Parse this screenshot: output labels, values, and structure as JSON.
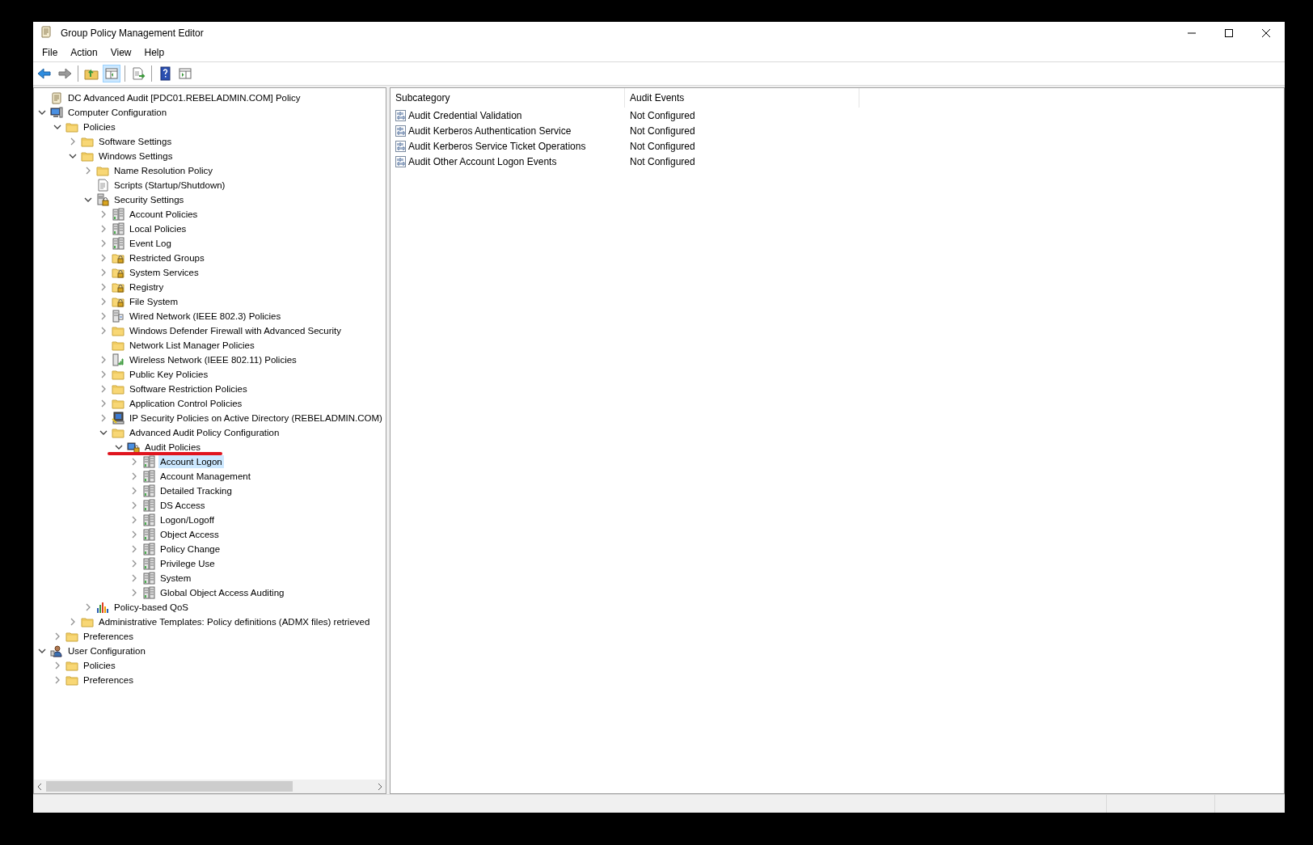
{
  "window": {
    "title": "Group Policy Management Editor"
  },
  "menu": [
    "File",
    "Action",
    "View",
    "Help"
  ],
  "toolbar": [
    {
      "kind": "back"
    },
    {
      "kind": "forward"
    },
    {
      "kind": "sep"
    },
    {
      "kind": "up",
      "pressed": false
    },
    {
      "kind": "tree",
      "pressed": true
    },
    {
      "kind": "sep"
    },
    {
      "kind": "export",
      "pressed": false
    },
    {
      "kind": "sep"
    },
    {
      "kind": "help",
      "pressed": false
    },
    {
      "kind": "view",
      "pressed": false
    }
  ],
  "tree": [
    {
      "label": "DC Advanced Audit [PDC01.REBELADMIN.COM] Policy",
      "kind": "scroll",
      "selected": false
    },
    {
      "label": "Computer Configuration",
      "kind": "computer",
      "expanded": true,
      "selected": false,
      "children": [
        {
          "label": "Policies",
          "kind": "folder",
          "expanded": true,
          "selected": false,
          "children": [
            {
              "label": "Software Settings",
              "kind": "folder",
              "expanded": false,
              "selected": false
            },
            {
              "label": "Windows Settings",
              "kind": "folder",
              "expanded": true,
              "selected": false,
              "children": [
                {
                  "label": "Name Resolution Policy",
                  "kind": "folder",
                  "expanded": false,
                  "selected": false
                },
                {
                  "label": "Scripts (Startup/Shutdown)",
                  "kind": "script",
                  "selected": false
                },
                {
                  "label": "Security Settings",
                  "kind": "security",
                  "expanded": true,
                  "selected": false,
                  "children": [
                    {
                      "label": "Account Policies",
                      "kind": "policy",
                      "expanded": false,
                      "selected": false
                    },
                    {
                      "label": "Local Policies",
                      "kind": "policy",
                      "expanded": false,
                      "selected": false
                    },
                    {
                      "label": "Event Log",
                      "kind": "policy",
                      "expanded": false,
                      "selected": false
                    },
                    {
                      "label": "Restricted Groups",
                      "kind": "lockfolder",
                      "expanded": false,
                      "selected": false
                    },
                    {
                      "label": "System Services",
                      "kind": "lockfolder",
                      "expanded": false,
                      "selected": false
                    },
                    {
                      "label": "Registry",
                      "kind": "lockfolder",
                      "expanded": false,
                      "selected": false
                    },
                    {
                      "label": "File System",
                      "kind": "lockfolder",
                      "expanded": false,
                      "selected": false
                    },
                    {
                      "label": "Wired Network (IEEE 802.3) Policies",
                      "kind": "wired",
                      "expanded": false,
                      "selected": false
                    },
                    {
                      "label": "Windows Defender Firewall with Advanced Security",
                      "kind": "folder",
                      "expanded": false,
                      "selected": false
                    },
                    {
                      "label": "Network List Manager Policies",
                      "kind": "folder",
                      "selected": false
                    },
                    {
                      "label": "Wireless Network (IEEE 802.11) Policies",
                      "kind": "wireless",
                      "expanded": false,
                      "selected": false
                    },
                    {
                      "label": "Public Key Policies",
                      "kind": "folder",
                      "expanded": false,
                      "selected": false
                    },
                    {
                      "label": "Software Restriction Policies",
                      "kind": "folder",
                      "expanded": false,
                      "selected": false
                    },
                    {
                      "label": "Application Control Policies",
                      "kind": "folder",
                      "expanded": false,
                      "selected": false
                    },
                    {
                      "label": "IP Security Policies on Active Directory (REBELADMIN.COM)",
                      "kind": "ipsec",
                      "expanded": false,
                      "selected": false
                    },
                    {
                      "label": "Advanced Audit Policy Configuration",
                      "kind": "folder",
                      "expanded": true,
                      "selected": false,
                      "children": [
                        {
                          "label": "Audit Policies",
                          "kind": "audit",
                          "expanded": true,
                          "selected": false,
                          "underlined": true,
                          "children": [
                            {
                              "label": "Account Logon",
                              "kind": "policy",
                              "expanded": false,
                              "selected": true
                            },
                            {
                              "label": "Account Management",
                              "kind": "policy",
                              "expanded": false,
                              "selected": false
                            },
                            {
                              "label": "Detailed Tracking",
                              "kind": "policy",
                              "expanded": false,
                              "selected": false
                            },
                            {
                              "label": "DS Access",
                              "kind": "policy",
                              "expanded": false,
                              "selected": false
                            },
                            {
                              "label": "Logon/Logoff",
                              "kind": "policy",
                              "expanded": false,
                              "selected": false
                            },
                            {
                              "label": "Object Access",
                              "kind": "policy",
                              "expanded": false,
                              "selected": false
                            },
                            {
                              "label": "Policy Change",
                              "kind": "policy",
                              "expanded": false,
                              "selected": false
                            },
                            {
                              "label": "Privilege Use",
                              "kind": "policy",
                              "expanded": false,
                              "selected": false
                            },
                            {
                              "label": "System",
                              "kind": "policy",
                              "expanded": false,
                              "selected": false
                            },
                            {
                              "label": "Global Object Access Auditing",
                              "kind": "policy",
                              "expanded": false,
                              "selected": false
                            }
                          ]
                        }
                      ]
                    }
                  ]
                },
                {
                  "label": "Policy-based QoS",
                  "kind": "qos",
                  "expanded": false,
                  "selected": false
                }
              ]
            },
            {
              "label": "Administrative Templates: Policy definitions (ADMX files) retrieved",
              "kind": "folder",
              "expanded": false,
              "selected": false
            }
          ]
        },
        {
          "label": "Preferences",
          "kind": "folder",
          "expanded": false,
          "selected": false
        }
      ]
    },
    {
      "label": "User Configuration",
      "kind": "user",
      "expanded": true,
      "selected": false,
      "children": [
        {
          "label": "Policies",
          "kind": "folder",
          "expanded": false,
          "selected": false
        },
        {
          "label": "Preferences",
          "kind": "folder",
          "expanded": false,
          "selected": false
        }
      ]
    }
  ],
  "list": {
    "columns": [
      "Subcategory",
      "Audit Events"
    ],
    "rows": [
      {
        "subcategory": "Audit Credential Validation",
        "audit_events": "Not Configured"
      },
      {
        "subcategory": "Audit Kerberos Authentication Service",
        "audit_events": "Not Configured"
      },
      {
        "subcategory": "Audit Kerberos Service Ticket Operations",
        "audit_events": "Not Configured"
      },
      {
        "subcategory": "Audit Other Account Logon Events",
        "audit_events": "Not Configured"
      }
    ]
  }
}
